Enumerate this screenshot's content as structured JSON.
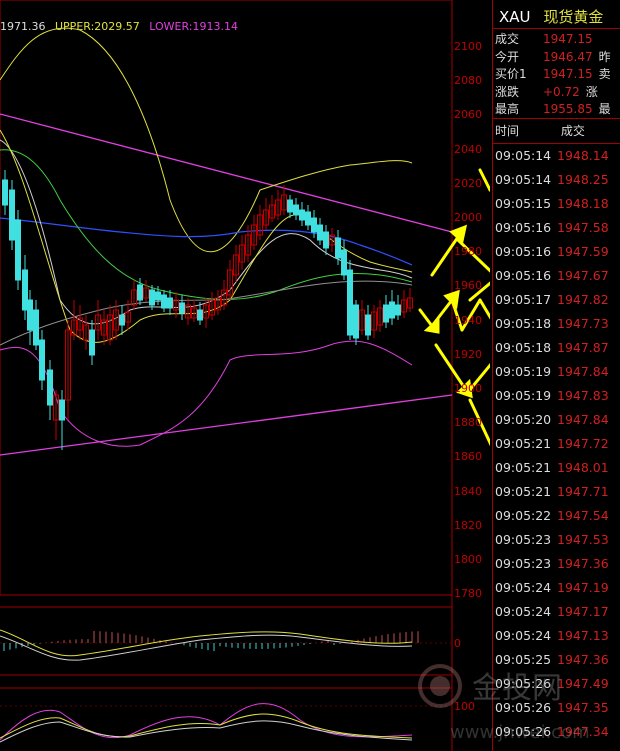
{
  "header": {
    "mid": "1971.36",
    "upper": "UPPER:2029.57",
    "lower": "LOWER:1913.14"
  },
  "colors": {
    "up": "#c00000",
    "down": "#40e0e0",
    "upper": "#ffff40",
    "lower": "#ff40ff",
    "axis": "#c00000"
  },
  "y_axis": {
    "main": [
      "2100",
      "2080",
      "2060",
      "2040",
      "2020",
      "2000",
      "1980",
      "1960",
      "1940",
      "1920",
      "1900",
      "1880",
      "1860",
      "1840",
      "1820",
      "1800",
      "1780"
    ],
    "macd_zero": "0",
    "kdj_100": "100"
  },
  "quote": {
    "symbol": "XAU",
    "name": "现货黄金",
    "rows": [
      {
        "label": "成交",
        "value": "1947.15",
        "extra": ""
      },
      {
        "label": "今开",
        "value": "1946.47",
        "extra": "昨"
      },
      {
        "label": "买价1",
        "value": "1947.15",
        "extra": "卖"
      },
      {
        "label": "涨跌",
        "value": "+0.72",
        "extra": "涨"
      },
      {
        "label": "最高",
        "value": "1955.85",
        "extra": "最"
      }
    ]
  },
  "ticks_header": {
    "time": "时间",
    "price": "成交"
  },
  "ticks": [
    {
      "time": "09:05:14",
      "price": "1948.14"
    },
    {
      "time": "09:05:14",
      "price": "1948.25"
    },
    {
      "time": "09:05:15",
      "price": "1948.18"
    },
    {
      "time": "09:05:16",
      "price": "1947.58"
    },
    {
      "time": "09:05:16",
      "price": "1947.59"
    },
    {
      "time": "09:05:16",
      "price": "1947.67"
    },
    {
      "time": "09:05:17",
      "price": "1947.82"
    },
    {
      "time": "09:05:18",
      "price": "1947.73"
    },
    {
      "time": "09:05:18",
      "price": "1947.87"
    },
    {
      "time": "09:05:19",
      "price": "1947.84"
    },
    {
      "time": "09:05:19",
      "price": "1947.83"
    },
    {
      "time": "09:05:20",
      "price": "1947.84"
    },
    {
      "time": "09:05:21",
      "price": "1947.72"
    },
    {
      "time": "09:05:21",
      "price": "1948.01"
    },
    {
      "time": "09:05:21",
      "price": "1947.71"
    },
    {
      "time": "09:05:22",
      "price": "1947.54"
    },
    {
      "time": "09:05:23",
      "price": "1947.53"
    },
    {
      "time": "09:05:23",
      "price": "1947.36"
    },
    {
      "time": "09:05:24",
      "price": "1947.19"
    },
    {
      "time": "09:05:24",
      "price": "1947.17"
    },
    {
      "time": "09:05:24",
      "price": "1947.13"
    },
    {
      "time": "09:05:25",
      "price": "1947.36"
    },
    {
      "time": "09:05:26",
      "price": "1947.49"
    },
    {
      "time": "09:05:26",
      "price": "1947.35"
    },
    {
      "time": "09:05:26",
      "price": "1947.34"
    }
  ],
  "watermark": {
    "brand": "金投网",
    "url": "www.jnwei.com"
  }
}
